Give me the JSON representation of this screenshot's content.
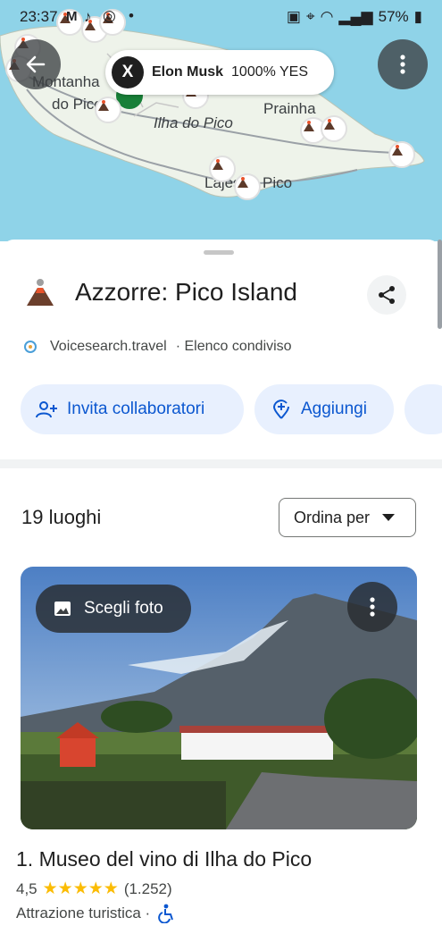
{
  "status_bar": {
    "time": "23:37",
    "battery": "57%"
  },
  "map": {
    "labels": [
      "Montanha",
      "do Pico",
      "Ilha do Pico",
      "Prainha",
      "Lajes",
      "Pico"
    ],
    "water_color": "#8fd3e8",
    "land_color": "#e8f0e6"
  },
  "ad_chip": {
    "logo": "X",
    "name": "Elon Musk",
    "tag": "1000% YES"
  },
  "list": {
    "title": "Azzorre: Pico Island",
    "source": "Voicesearch.travel",
    "shared_label": "· Elenco condiviso",
    "chips": [
      "Invita collaboratori",
      "Aggiungi"
    ],
    "count": "19 luoghi",
    "sort_label": "Ordina per"
  },
  "place": {
    "photo_button": "Scegli foto",
    "title": "1. Museo del vino di Ilha do Pico",
    "rating": "4,5",
    "stars": "★★★★★",
    "reviews": "(1.252)",
    "category": "Attrazione turistica ·"
  },
  "colors": {
    "accent": "#0b57d0",
    "chip_bg": "#e8f0fe",
    "star": "#fbbc04"
  }
}
